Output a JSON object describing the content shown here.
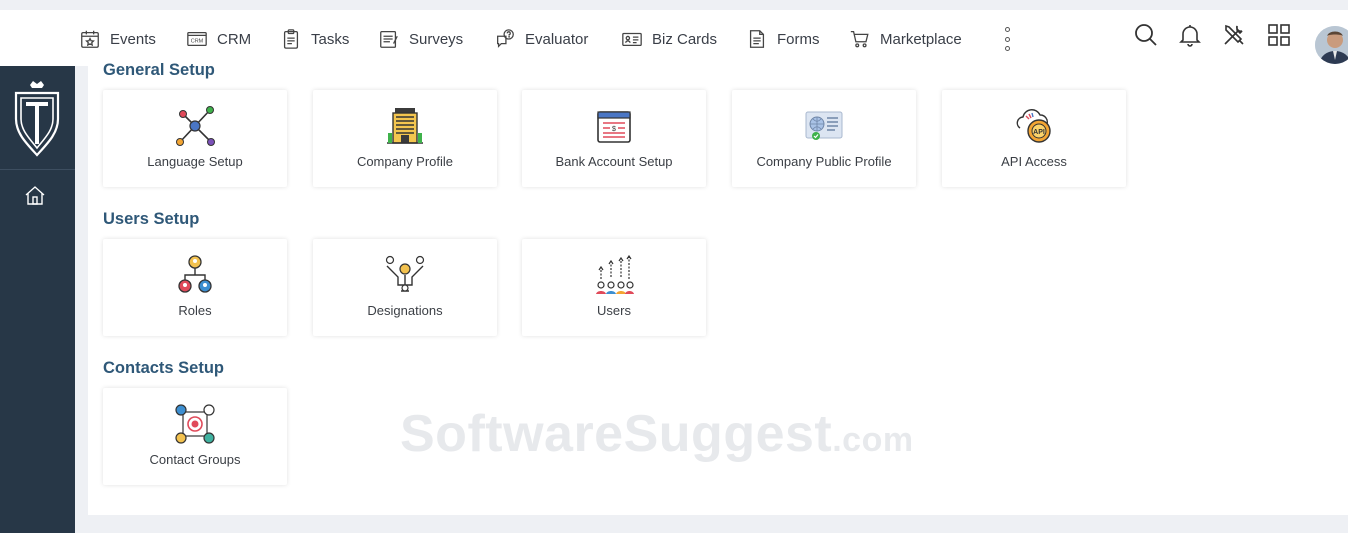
{
  "nav": {
    "items": [
      {
        "label": "Events",
        "icon": "calendar-star-icon"
      },
      {
        "label": "CRM",
        "icon": "crm-icon"
      },
      {
        "label": "Tasks",
        "icon": "clipboard-list-icon"
      },
      {
        "label": "Surveys",
        "icon": "survey-form-icon"
      },
      {
        "label": "Evaluator",
        "icon": "question-bubble-icon"
      },
      {
        "label": "Biz Cards",
        "icon": "business-card-icon"
      },
      {
        "label": "Forms",
        "icon": "document-form-icon"
      },
      {
        "label": "Marketplace",
        "icon": "shopping-cart-icon"
      }
    ],
    "right_icons": [
      "search-icon",
      "bell-icon",
      "tools-icon",
      "apps-grid-icon",
      "avatar"
    ]
  },
  "sections": {
    "general": {
      "title": "General Setup",
      "cards": [
        {
          "label": "Language Setup",
          "icon": "language-network-icon"
        },
        {
          "label": "Company Profile",
          "icon": "office-building-icon"
        },
        {
          "label": "Bank Account Setup",
          "icon": "bank-account-icon"
        },
        {
          "label": "Company Public Profile",
          "icon": "public-profile-icon"
        },
        {
          "label": "API Access",
          "icon": "api-gear-cloud-icon"
        }
      ]
    },
    "users": {
      "title": "Users Setup",
      "cards": [
        {
          "label": "Roles",
          "icon": "roles-hierarchy-icon"
        },
        {
          "label": "Designations",
          "icon": "designations-funnel-icon"
        },
        {
          "label": "Users",
          "icon": "users-growth-icon"
        }
      ]
    },
    "contacts": {
      "title": "Contacts Setup",
      "cards": [
        {
          "label": "Contact Groups",
          "icon": "contact-groups-icon"
        }
      ]
    }
  },
  "watermark": {
    "main": "SoftwareSuggest",
    "suffix": ".com"
  },
  "colors": {
    "sidebar": "#273747",
    "section_title": "#2f5878",
    "background": "#eef0f4"
  }
}
